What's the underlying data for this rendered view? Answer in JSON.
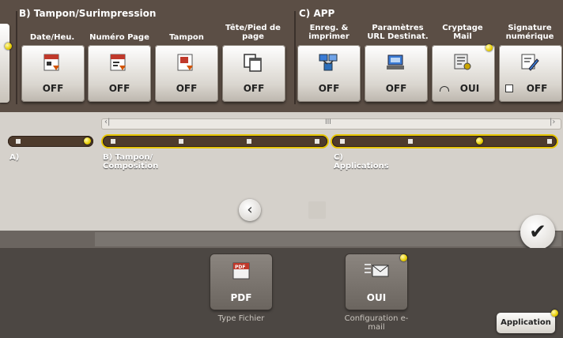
{
  "sections": {
    "tampon_title": "B)  Tampon/Surimpression",
    "app_title": "C)  APP"
  },
  "functions": {
    "date_heure": {
      "label": "Date/Heu.",
      "state": "OFF"
    },
    "numero_page": {
      "label": "Numéro Page",
      "state": "OFF"
    },
    "tampon": {
      "label": "Tampon",
      "state": "OFF"
    },
    "tete_pied": {
      "label": "Tête/Pied de page",
      "state": "OFF"
    },
    "enreg_imprimer": {
      "label": "Enreg. & imprimer",
      "state": "OFF"
    },
    "parametres_url": {
      "label": "Paramètres URL Destinat.",
      "state": "OFF"
    },
    "cryptage_mail": {
      "label": "Cryptage Mail",
      "state": "OUI"
    },
    "signature_numerique": {
      "label": "Signature numérique",
      "state": "OFF"
    }
  },
  "navigation": {
    "scrollbar_middle": "III",
    "group_a": "A)",
    "group_b": "B) Tampon/ Composition",
    "group_c": "C) Applications"
  },
  "bottom": {
    "type_fichier": {
      "value": "PDF",
      "label": "Type Fichier",
      "icon_text": "PDF"
    },
    "config_email": {
      "value": "OUI",
      "label": "Configuration e-mail"
    },
    "application_button": "Application"
  },
  "colors": {
    "indicator": "#e6cc00",
    "topbar": "#5b4e45",
    "track": "#4e3b2c"
  },
  "icons": {
    "ok": "checkmark-icon",
    "back": "chevron-left-icon"
  }
}
